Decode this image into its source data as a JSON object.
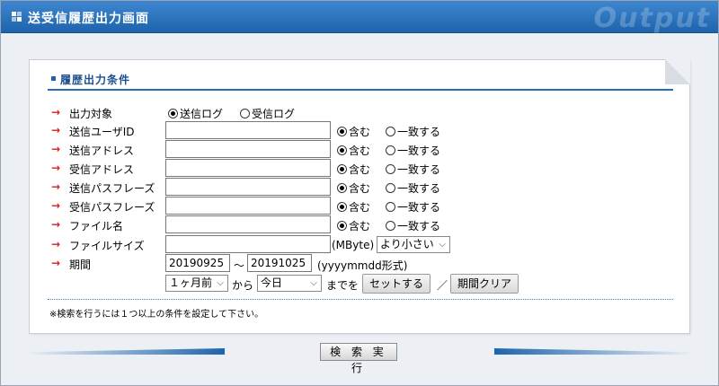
{
  "header": {
    "title": "送受信履歴出力画面",
    "watermark": "Output"
  },
  "panel": {
    "title": "履歴出力条件"
  },
  "rows": {
    "target": {
      "label": "出力対象",
      "opt1": "送信ログ",
      "opt2": "受信ログ",
      "selected": "送信ログ"
    },
    "sender_id": {
      "label": "送信ユーザID",
      "value": "",
      "opt1": "含む",
      "opt2": "一致する"
    },
    "sender_addr": {
      "label": "送信アドレス",
      "value": "",
      "opt1": "含む",
      "opt2": "一致する"
    },
    "recv_addr": {
      "label": "受信アドレス",
      "value": "",
      "opt1": "含む",
      "opt2": "一致する"
    },
    "send_pass": {
      "label": "送信パスフレーズ",
      "value": "",
      "opt1": "含む",
      "opt2": "一致する"
    },
    "recv_pass": {
      "label": "受信パスフレーズ",
      "value": "",
      "opt1": "含む",
      "opt2": "一致する"
    },
    "filename": {
      "label": "ファイル名",
      "value": "",
      "opt1": "含む",
      "opt2": "一致する"
    },
    "filesize": {
      "label": "ファイルサイズ",
      "value": "",
      "unit": "(MByte)",
      "cmp": "より小さい"
    },
    "period": {
      "label": "期間",
      "from": "20190925",
      "tilde": "～",
      "to": "20191025",
      "format": "(yyyymmdd形式)",
      "rel_from": "１ヶ月前",
      "kara": "から",
      "rel_to": "今日",
      "made": "までを",
      "set_btn": "セットする",
      "slash": "／",
      "clear_btn": "期間クリア"
    }
  },
  "note": "※検索を行うには１つ以上の条件を設定して下さい。",
  "exec_btn": "検 索 実 行"
}
